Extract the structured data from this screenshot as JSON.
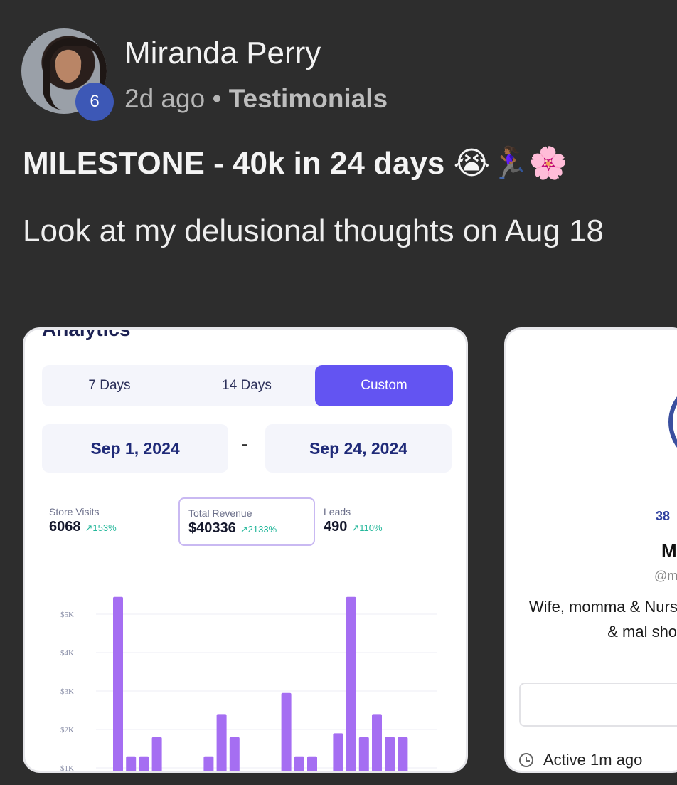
{
  "post": {
    "author": "Miranda Perry",
    "level": "6",
    "time": "2d ago",
    "separator": "•",
    "category": "Testimonials",
    "title": "MILESTONE - 40k in 24 days",
    "title_emojis": "😭🏃🏾‍♀️🌸",
    "body": "Look at my delusional thoughts on Aug 18"
  },
  "card1": {
    "heading": "Analytics",
    "tabs": [
      "7 Days",
      "14 Days",
      "Custom"
    ],
    "active_tab": "Custom",
    "date_start": "Sep 1, 2024",
    "date_dash": "-",
    "date_end": "Sep 24, 2024",
    "stats": {
      "visits": {
        "label": "Store Visits",
        "value": "6068",
        "change": "↗153%"
      },
      "revenue": {
        "label": "Total Revenue",
        "value": "$40336",
        "change": "↗2133%"
      },
      "leads": {
        "label": "Leads",
        "value": "490",
        "change": "↗110%"
      }
    }
  },
  "chart_data": {
    "type": "bar",
    "ylim": [
      0,
      5500
    ],
    "y_ticks": [
      "$1K",
      "$2K",
      "$3K",
      "$4K",
      "$5K"
    ],
    "tick_values": [
      1000,
      2000,
      3000,
      4000,
      5000
    ],
    "values": [
      5450,
      1300,
      1300,
      1800,
      null,
      null,
      null,
      1300,
      2400,
      1800,
      null,
      null,
      null,
      2950,
      1300,
      1300,
      null,
      1900,
      5450,
      1800,
      2400,
      1800,
      1800
    ],
    "bar_color": "#a56ef2",
    "grid": true
  },
  "card2": {
    "count": "38",
    "name": "M",
    "handle": "@m",
    "bio": "Wife, momma & Nurs quitting nursing & mal shop 🫶",
    "status": "Active 1m ago"
  },
  "colors": {
    "background": "#2d2d2d",
    "accent": "#6354f2",
    "badge": "#3d58b6",
    "positive": "#23b79a"
  }
}
